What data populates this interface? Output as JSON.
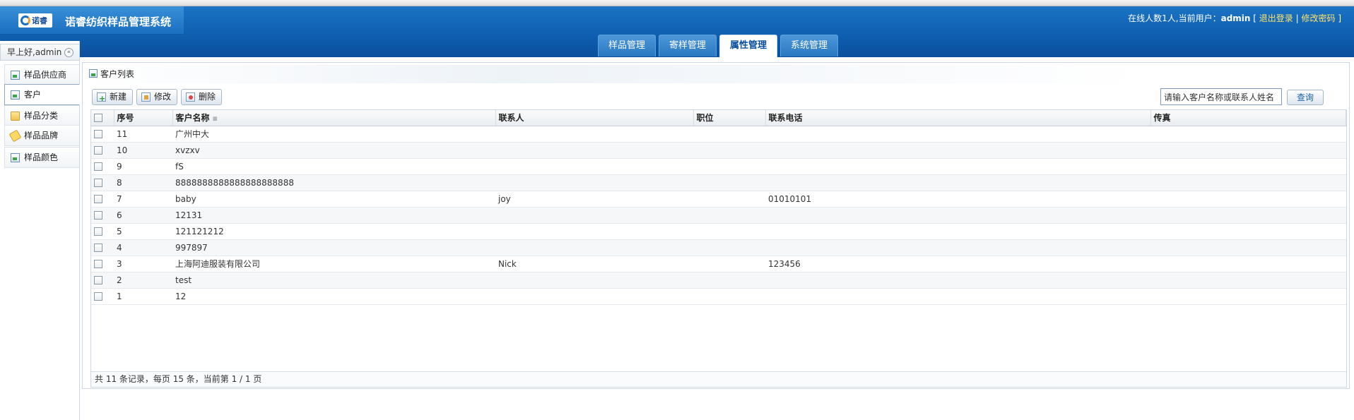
{
  "app": {
    "logo_text": "诺睿",
    "title": "诺睿纺织样品管理系统"
  },
  "user_info": {
    "prefix": "在线人数1人,当前用户：",
    "username": "admin",
    "logout": "退出登录",
    "separator": "|",
    "change_password": "修改密码"
  },
  "tabs": [
    {
      "label": "样品管理",
      "active": false
    },
    {
      "label": "寄样管理",
      "active": false
    },
    {
      "label": "属性管理",
      "active": true
    },
    {
      "label": "系统管理",
      "active": false
    }
  ],
  "sidebar": {
    "greeting": "早上好,admin",
    "items": [
      {
        "label": "样品供应商",
        "icon": "document-icon"
      },
      {
        "label": "客户",
        "icon": "document-icon",
        "active": true
      },
      {
        "label": "样品分类",
        "icon": "folder-icon"
      },
      {
        "label": "样品品牌",
        "icon": "tag-icon"
      },
      {
        "label": "样品颜色",
        "icon": "document-icon"
      }
    ]
  },
  "panel": {
    "title": "客户列表",
    "toolbar": {
      "new_label": "新建",
      "edit_label": "修改",
      "delete_label": "删除"
    },
    "search": {
      "placeholder": "请输入客户名称或联系人姓名",
      "value": "请输入客户名称或联系人姓名",
      "button_label": "查询"
    }
  },
  "table": {
    "columns": [
      "序号",
      "客户名称",
      "联系人",
      "职位",
      "联系电话",
      "传真"
    ],
    "rows": [
      {
        "no": "11",
        "name": "广州中大",
        "contact": "",
        "position": "",
        "phone": "",
        "fax": ""
      },
      {
        "no": "10",
        "name": "xvzxv",
        "contact": "",
        "position": "",
        "phone": "",
        "fax": ""
      },
      {
        "no": "9",
        "name": "fS",
        "contact": "",
        "position": "",
        "phone": "",
        "fax": ""
      },
      {
        "no": "8",
        "name": "8888888888888888888888",
        "contact": "",
        "position": "",
        "phone": "",
        "fax": ""
      },
      {
        "no": "7",
        "name": "baby",
        "contact": "joy",
        "position": "",
        "phone": "01010101",
        "fax": ""
      },
      {
        "no": "6",
        "name": "12131",
        "contact": "",
        "position": "",
        "phone": "",
        "fax": ""
      },
      {
        "no": "5",
        "name": "121121212",
        "contact": "",
        "position": "",
        "phone": "",
        "fax": ""
      },
      {
        "no": "4",
        "name": "997897",
        "contact": "",
        "position": "",
        "phone": "",
        "fax": ""
      },
      {
        "no": "3",
        "name": "上海阿迪服装有限公司",
        "contact": "Nick",
        "position": "",
        "phone": "123456",
        "fax": ""
      },
      {
        "no": "2",
        "name": "test",
        "contact": "",
        "position": "",
        "phone": "",
        "fax": ""
      },
      {
        "no": "1",
        "name": "12",
        "contact": "",
        "position": "",
        "phone": "",
        "fax": ""
      }
    ],
    "footer": "共 11 条记录，每页 15 条，当前第 1 / 1 页"
  }
}
